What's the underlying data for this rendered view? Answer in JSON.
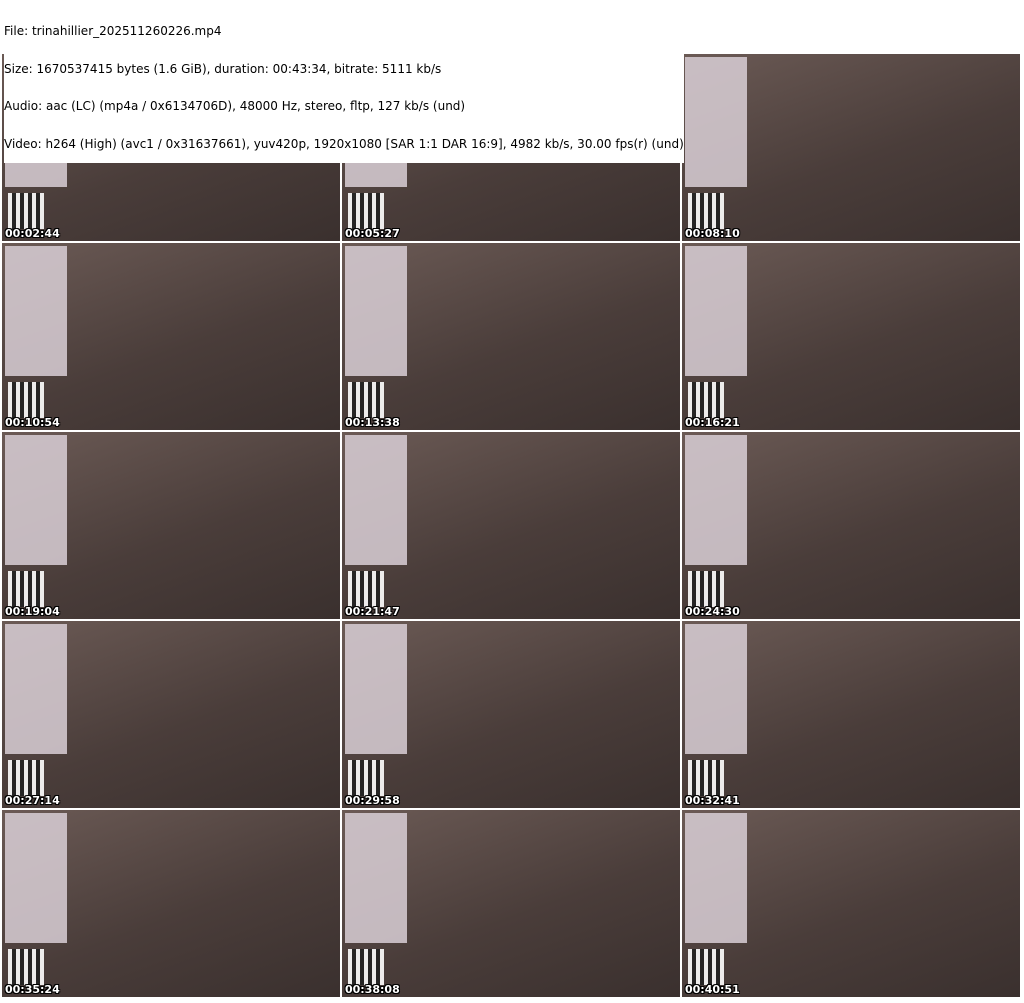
{
  "header": {
    "file": "File: trinahillier_202511260226.mp4",
    "size": "Size: 1670537415 bytes (1.6 GiB), duration: 00:43:34, bitrate: 5111 kb/s",
    "audio": "Audio: aac (LC) (mp4a / 0x6134706D), 48000 Hz, stereo, fltp, 127 kb/s (und)",
    "video": "Video: h264 (High) (avc1 / 0x31637661), yuv420p, 1920x1080 [SAR 1:1 DAR 16:9], 4982 kb/s, 30.00 fps(r) (und)"
  },
  "thumbnails": [
    {
      "timestamp": "00:02:44"
    },
    {
      "timestamp": "00:05:27"
    },
    {
      "timestamp": "00:08:10"
    },
    {
      "timestamp": "00:10:54"
    },
    {
      "timestamp": "00:13:38"
    },
    {
      "timestamp": "00:16:21"
    },
    {
      "timestamp": "00:19:04"
    },
    {
      "timestamp": "00:21:47"
    },
    {
      "timestamp": "00:24:30"
    },
    {
      "timestamp": "00:27:14"
    },
    {
      "timestamp": "00:29:58"
    },
    {
      "timestamp": "00:32:41"
    },
    {
      "timestamp": "00:35:24"
    },
    {
      "timestamp": "00:38:08"
    },
    {
      "timestamp": "00:40:51"
    }
  ]
}
